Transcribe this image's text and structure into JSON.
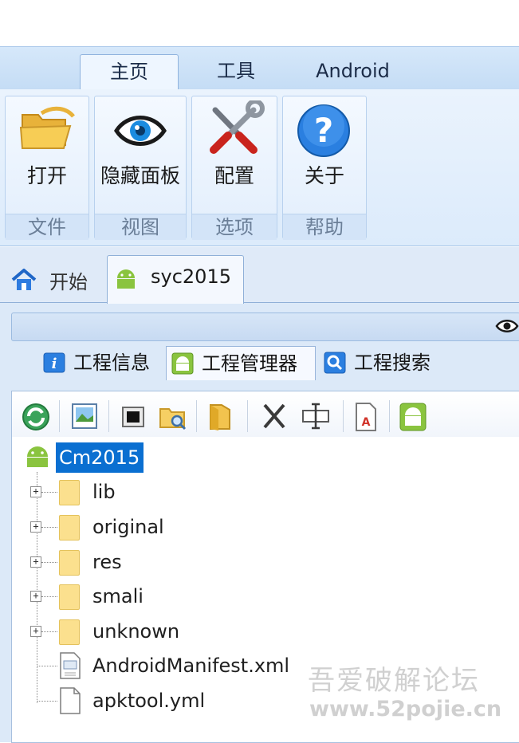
{
  "ribbon": {
    "tabs": [
      {
        "label": "主页",
        "active": true
      },
      {
        "label": "工具",
        "active": false
      },
      {
        "label": "Android",
        "active": false
      }
    ],
    "groups": [
      {
        "label": "文件",
        "buttons": [
          {
            "label": "打开",
            "icon": "folder-open-icon"
          }
        ]
      },
      {
        "label": "视图",
        "buttons": [
          {
            "label": "隐藏面板",
            "icon": "eye-icon"
          }
        ]
      },
      {
        "label": "选项",
        "buttons": [
          {
            "label": "配置",
            "icon": "tools-icon"
          }
        ]
      },
      {
        "label": "帮助",
        "buttons": [
          {
            "label": "关于",
            "icon": "help-icon"
          }
        ]
      }
    ]
  },
  "document_tabs": [
    {
      "label": "开始",
      "icon": "home-icon",
      "active": false
    },
    {
      "label": "syc2015",
      "icon": "android-icon",
      "active": true
    }
  ],
  "sub_tabs": [
    {
      "label": "工程信息",
      "icon": "info-icon",
      "active": false
    },
    {
      "label": "工程管理器",
      "icon": "android-icon",
      "active": true
    },
    {
      "label": "工程搜索",
      "icon": "search-icon",
      "active": false
    }
  ],
  "toolbar_icons": [
    "refresh-icon",
    "image-icon",
    "window-icon",
    "folder-search-icon",
    "folder-icon",
    "cut-icon",
    "rename-icon",
    "pdf-icon",
    "android-icon"
  ],
  "tree": {
    "root": "Cm2015",
    "items": [
      {
        "label": "lib",
        "type": "folder"
      },
      {
        "label": "original",
        "type": "folder"
      },
      {
        "label": "res",
        "type": "folder"
      },
      {
        "label": "smali",
        "type": "folder"
      },
      {
        "label": "unknown",
        "type": "folder"
      },
      {
        "label": "AndroidManifest.xml",
        "type": "xml-file"
      },
      {
        "label": "apktool.yml",
        "type": "file"
      }
    ]
  },
  "watermark": {
    "line1": "吾爱破解论坛",
    "line2": "www.52pojie.cn"
  },
  "colors": {
    "ribbon_bg": "#dcebfb",
    "selection": "#0a6fd1",
    "folder": "#fbe08e",
    "android_green": "#8ac43f"
  }
}
